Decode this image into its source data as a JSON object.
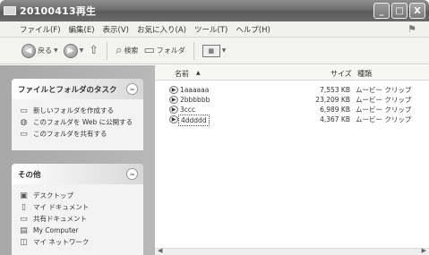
{
  "window": {
    "title": "20100413再生",
    "min": "_",
    "max": "□",
    "close": "X"
  },
  "menu": [
    "ファイル(F)",
    "編集(E)",
    "表示(V)",
    "お気に入り(A)",
    "ツール(T)",
    "ヘルプ(H)"
  ],
  "toolbar": {
    "back_label": "戻る",
    "forward_label": "",
    "search_label": "検索",
    "folders_label": "フォルダ",
    "view_label": "▦"
  },
  "tasks_box": {
    "title": "ファイルとフォルダのタスク",
    "items": [
      {
        "icon": "new-folder-icon",
        "label": "新しいフォルダを作成する"
      },
      {
        "icon": "globe-icon",
        "label": "このフォルダを Web に公開する"
      },
      {
        "icon": "share-icon",
        "label": "このフォルダを共有する"
      }
    ]
  },
  "other_box": {
    "title": "その他",
    "items": [
      {
        "icon": "desktop-icon",
        "label": "デスクトップ"
      },
      {
        "icon": "my-documents-icon",
        "label": "マイ ドキュメント"
      },
      {
        "icon": "shared-documents-icon",
        "label": "共有ドキュメント"
      },
      {
        "icon": "my-computer-icon",
        "label": "My Computer"
      },
      {
        "icon": "network-icon",
        "label": "マイ ネットワーク"
      }
    ]
  },
  "columns": {
    "name": "名前",
    "sort": "▲",
    "size": "サイズ",
    "type": "種類"
  },
  "files": [
    {
      "name": "1aaaaaa",
      "size": "7,553 KB",
      "type": "ムービー クリップ"
    },
    {
      "name": "2bbbbbb",
      "size": "23,209 KB",
      "type": "ムービー クリップ"
    },
    {
      "name": "3ccc",
      "size": "6,989 KB",
      "type": "ムービー クリップ"
    },
    {
      "name": "4ddddd",
      "size": "4,367 KB",
      "type": "ムービー クリップ"
    }
  ]
}
